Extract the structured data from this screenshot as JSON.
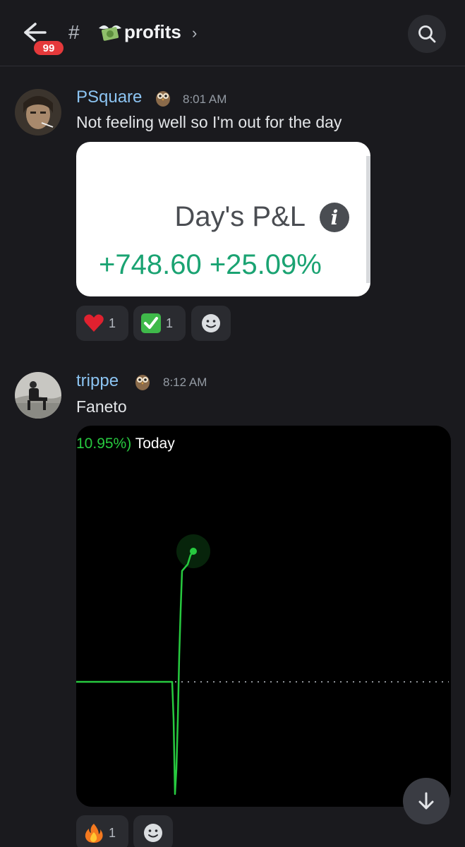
{
  "header": {
    "unread_count": "99",
    "hash": "#",
    "channel_name": "profits",
    "channel_emoji": "money-with-wings-icon",
    "chevron": "›"
  },
  "messages": [
    {
      "username": "PSquare",
      "badge_icon": "owl-icon",
      "time": "8:01 AM",
      "text": "Not feeling well so I'm out for the day",
      "attachment": {
        "label": "Day's P&L",
        "info": "i",
        "value": "+748.60 +25.09%"
      },
      "reactions": [
        {
          "emoji": "red-heart-icon",
          "count": "1"
        },
        {
          "emoji": "check-mark-button-icon",
          "count": "1"
        }
      ]
    },
    {
      "username": "trippe",
      "badge_icon": "owl-icon",
      "time": "8:12 AM",
      "text": "Faneto",
      "attachment": {
        "change_text": "10.95%)",
        "period": "Today"
      },
      "reactions": [
        {
          "emoji": "fire-icon",
          "count": "1"
        }
      ]
    }
  ],
  "colors": {
    "background": "#1a1a1e",
    "username": "#8cc4f2",
    "gain_green": "#1aa372",
    "chart_line": "#27c93f",
    "badge_red": "#e5393b"
  },
  "chart_data": {
    "type": "line",
    "title": "",
    "series": [
      {
        "values": [
          0,
          0,
          0,
          0,
          0,
          0,
          0,
          -0.3,
          -0.9,
          -0.7,
          -0.3,
          0.2,
          0.55,
          0.85,
          0.9,
          0.97,
          1.0
        ]
      }
    ],
    "baseline": 0,
    "grid": false,
    "xlabel": "",
    "ylabel": ""
  }
}
